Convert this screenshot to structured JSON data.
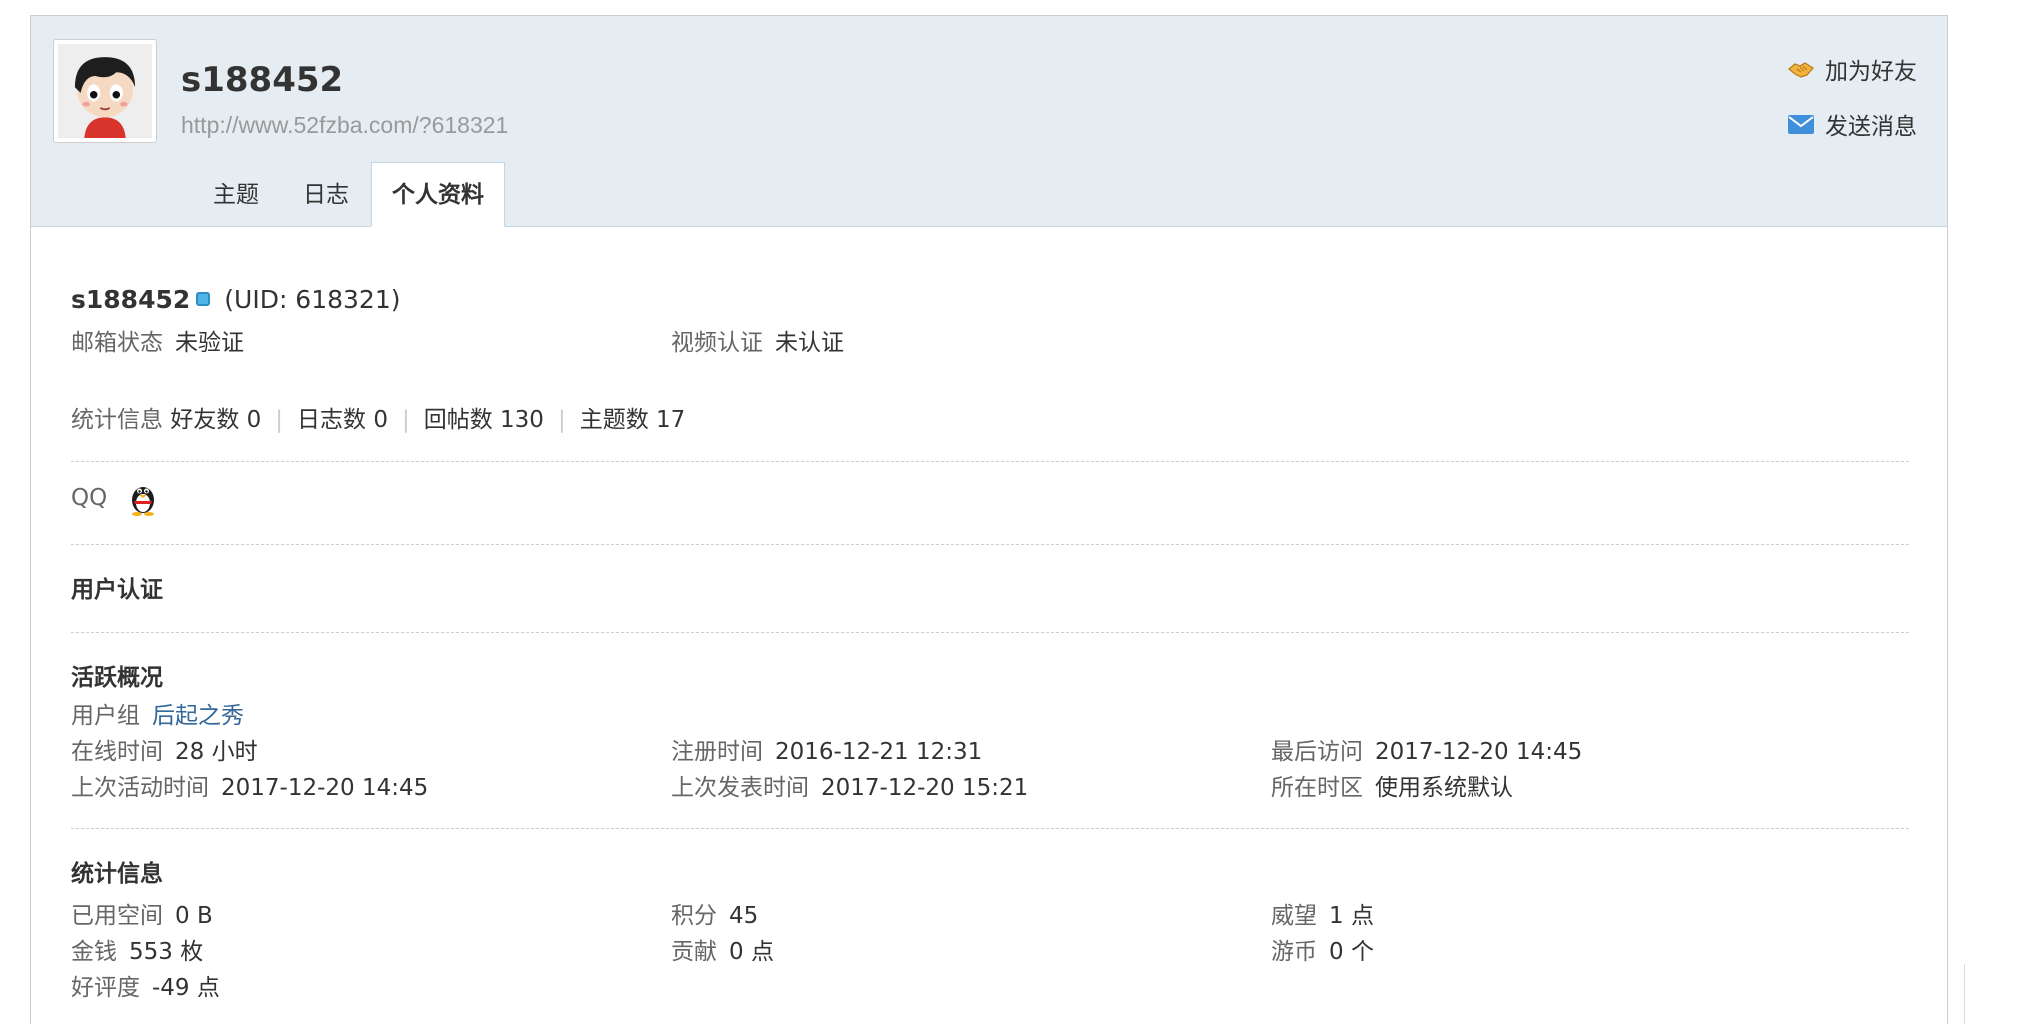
{
  "header": {
    "username": "s188452",
    "homepage": "http://www.52fzba.com/?618321",
    "add_friend": "加为好友",
    "send_message": "发送消息"
  },
  "tabs": [
    {
      "label": "主题",
      "active": false
    },
    {
      "label": "日志",
      "active": false
    },
    {
      "label": "个人资料",
      "active": true
    }
  ],
  "profile": {
    "name": "s188452",
    "uid": "(UID: 618321)",
    "email_status_label": "邮箱状态",
    "email_status_value": "未验证",
    "video_auth_label": "视频认证",
    "video_auth_value": "未认证",
    "stats_label": "统计信息",
    "stats": [
      "好友数 0",
      "日志数 0",
      "回帖数 130",
      "主题数 17"
    ],
    "qq_label": "QQ"
  },
  "sections": {
    "user_auth": "用户认证",
    "activity": "活跃概况",
    "statistics": "统计信息"
  },
  "activity": {
    "group_label": "用户组",
    "group_value": "后起之秀",
    "rows": [
      [
        {
          "label": "在线时间",
          "value": "28 小时"
        },
        {
          "label": "注册时间",
          "value": "2016-12-21 12:31"
        },
        {
          "label": "最后访问",
          "value": "2017-12-20 14:45"
        }
      ],
      [
        {
          "label": "上次活动时间",
          "value": "2017-12-20 14:45"
        },
        {
          "label": "上次发表时间",
          "value": "2017-12-20 15:21"
        },
        {
          "label": "所在时区",
          "value": "使用系统默认"
        }
      ]
    ]
  },
  "statistics": {
    "rows": [
      [
        {
          "label": "已用空间",
          "value": "0 B"
        },
        {
          "label": "积分",
          "value": "45"
        },
        {
          "label": "威望",
          "value": "1 点"
        }
      ],
      [
        {
          "label": "金钱",
          "value": "553 枚"
        },
        {
          "label": "贡献",
          "value": "0 点"
        },
        {
          "label": "游币",
          "value": "0 个"
        }
      ],
      [
        {
          "label": "好评度",
          "value": "-49 点"
        }
      ]
    ]
  },
  "colors": {
    "header_bg": "#e5edf2",
    "link": "#336699",
    "online_badge": "#4fb4e6"
  }
}
